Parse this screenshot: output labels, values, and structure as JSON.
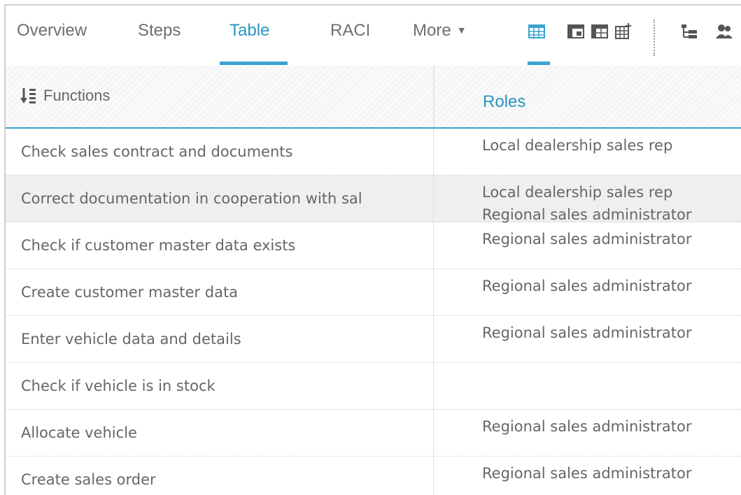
{
  "tabs": [
    {
      "label": "Overview"
    },
    {
      "label": "Steps"
    },
    {
      "label": "Table"
    },
    {
      "label": "RACI"
    },
    {
      "label": "More"
    }
  ],
  "active_tab": "Table",
  "toolbar_icons": [
    "table-view-icon",
    "table-matrix-icon",
    "table-add-icon",
    "hierarchy-icon",
    "people-icon"
  ],
  "header": {
    "functions_label": "Functions",
    "roles_label": "Roles"
  },
  "rows": [
    {
      "function": "Check sales contract and documents",
      "roles": [
        "Local dealership sales rep"
      ]
    },
    {
      "function": "Correct documentation in cooperation with sal",
      "roles": [
        "Local dealership sales rep",
        "Regional sales administrator"
      ]
    },
    {
      "function": "Check if customer master data exists",
      "roles": [
        "Regional sales administrator"
      ]
    },
    {
      "function": "Create customer master data",
      "roles": [
        "Regional sales administrator"
      ]
    },
    {
      "function": "Enter vehicle data and details",
      "roles": [
        "Regional sales administrator"
      ]
    },
    {
      "function": "Check if vehicle is in stock",
      "roles": []
    },
    {
      "function": "Allocate vehicle",
      "roles": [
        "Regional sales administrator"
      ]
    },
    {
      "function": "Create sales order",
      "roles": [
        "Regional sales administrator"
      ]
    }
  ],
  "colors": {
    "accent": "#3aa3cf",
    "active_text": "#2a95c1",
    "row_alt": "#efefef"
  }
}
